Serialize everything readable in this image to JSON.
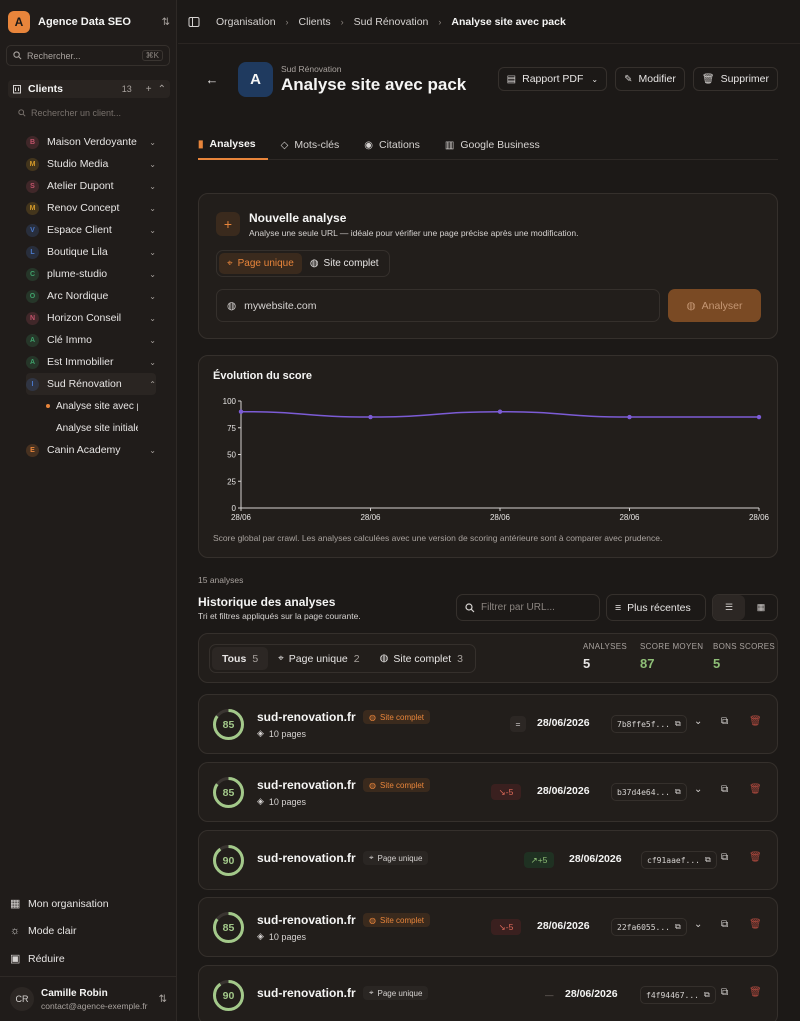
{
  "sidebar": {
    "org_initial": "A",
    "org_name": "Agence Data SEO",
    "search_label": "Rechercher...",
    "search_kbd": "⌘K",
    "clients_label": "Clients",
    "clients_count": "13",
    "client_search_placeholder": "Rechercher un client...",
    "clients": [
      {
        "initial": "B",
        "name": "Maison Verdoyante",
        "color": "#c2536b"
      },
      {
        "initial": "M",
        "name": "Studio Media",
        "color": "#d49a2a"
      },
      {
        "initial": "S",
        "name": "Atelier Dupont",
        "color": "#c2536b"
      },
      {
        "initial": "M",
        "name": "Renov Concept",
        "color": "#d49a2a"
      },
      {
        "initial": "V",
        "name": "Espace Client",
        "color": "#4a78c9"
      },
      {
        "initial": "L",
        "name": "Boutique Lila",
        "color": "#4a78c9"
      },
      {
        "initial": "C",
        "name": "plume-studio",
        "color": "#3fa06a"
      },
      {
        "initial": "O",
        "name": "Arc Nordique",
        "color": "#3fa06a"
      },
      {
        "initial": "N",
        "name": "Horizon Conseil",
        "color": "#c2536b"
      },
      {
        "initial": "A",
        "name": "Clé Immo",
        "color": "#3fa06a"
      },
      {
        "initial": "A",
        "name": "Est Immobilier",
        "color": "#3fa06a"
      },
      {
        "initial": "I",
        "name": "Sud Rénovation",
        "color": "#4a78c9"
      },
      {
        "initial": "E",
        "name": "Canin Academy",
        "color": "#e8853b"
      }
    ],
    "sub_items": [
      "Analyse site avec pack",
      "Analyse site initiale"
    ],
    "footer": {
      "org": "Mon organisation",
      "theme": "Mode clair",
      "collapse": "Réduire"
    },
    "user": {
      "initials": "CR",
      "name": "Camille Robin",
      "email": "contact@agence-exemple.fr"
    }
  },
  "breadcrumb": [
    "Organisation",
    "Clients",
    "Sud Rénovation",
    "Analyse site avec pack"
  ],
  "header": {
    "avatar": "A",
    "client": "Sud Rénovation",
    "title": "Analyse site avec pack",
    "report_btn": "Rapport PDF",
    "edit_btn": "Modifier",
    "delete_btn": "Supprimer"
  },
  "tabs": [
    "Analyses",
    "Mots-clés",
    "Citations",
    "Google Business"
  ],
  "new_analysis": {
    "title": "Nouvelle analyse",
    "desc": "Analyse une seule URL — idéale pour vérifier une page précise après une modification.",
    "mode_single": "Page unique",
    "mode_full": "Site complet",
    "url_value": "mywebsite.com",
    "submit": "Analyser"
  },
  "chart_data": {
    "type": "line",
    "title": "Évolution du score",
    "x": [
      "28/06",
      "28/06",
      "28/06",
      "28/06",
      "28/06"
    ],
    "values": [
      90,
      85,
      90,
      85,
      85
    ],
    "yticks": [
      0,
      25,
      50,
      75,
      100
    ],
    "ylim": [
      0,
      100
    ],
    "color": "#7c5cd6",
    "note": "Score global par crawl. Les analyses calculées avec une version de scoring antérieure sont à comparer avec prudence."
  },
  "history": {
    "count_label": "15 analyses",
    "title": "Historique des analyses",
    "subtitle": "Tri et filtres appliqués sur la page courante.",
    "filter_placeholder": "Filtrer par URL...",
    "sort_label": "Plus récentes",
    "filters": [
      {
        "label": "Tous",
        "count": "5"
      },
      {
        "label": "Page unique",
        "count": "2"
      },
      {
        "label": "Site complet",
        "count": "3"
      }
    ],
    "stats": [
      {
        "label": "ANALYSES",
        "value": "5",
        "color": "#f5f5f4"
      },
      {
        "label": "SCORE MOYEN",
        "value": "87",
        "color": "#8fbf77"
      },
      {
        "label": "BONS SCORES",
        "value": "5",
        "color": "#8fbf77"
      }
    ],
    "rows": [
      {
        "score": 85,
        "domain": "sud-renovation.fr",
        "type": "Site complet",
        "pages": "10 pages",
        "delta": "=",
        "date": "28/06/2026",
        "hash": "7b8ffe5f..."
      },
      {
        "score": 85,
        "domain": "sud-renovation.fr",
        "type": "Site complet",
        "pages": "10 pages",
        "delta": "-5",
        "date": "28/06/2026",
        "hash": "b37d4e64..."
      },
      {
        "score": 90,
        "domain": "sud-renovation.fr",
        "type": "Page unique",
        "pages": "",
        "delta": "+5",
        "date": "28/06/2026",
        "hash": "cf91aaef..."
      },
      {
        "score": 85,
        "domain": "sud-renovation.fr",
        "type": "Site complet",
        "pages": "10 pages",
        "delta": "-5",
        "date": "28/06/2026",
        "hash": "22fa6055..."
      },
      {
        "score": 90,
        "domain": "sud-renovation.fr",
        "type": "Page unique",
        "pages": "",
        "delta": "—",
        "date": "28/06/2026",
        "hash": "f4f94467..."
      }
    ]
  }
}
